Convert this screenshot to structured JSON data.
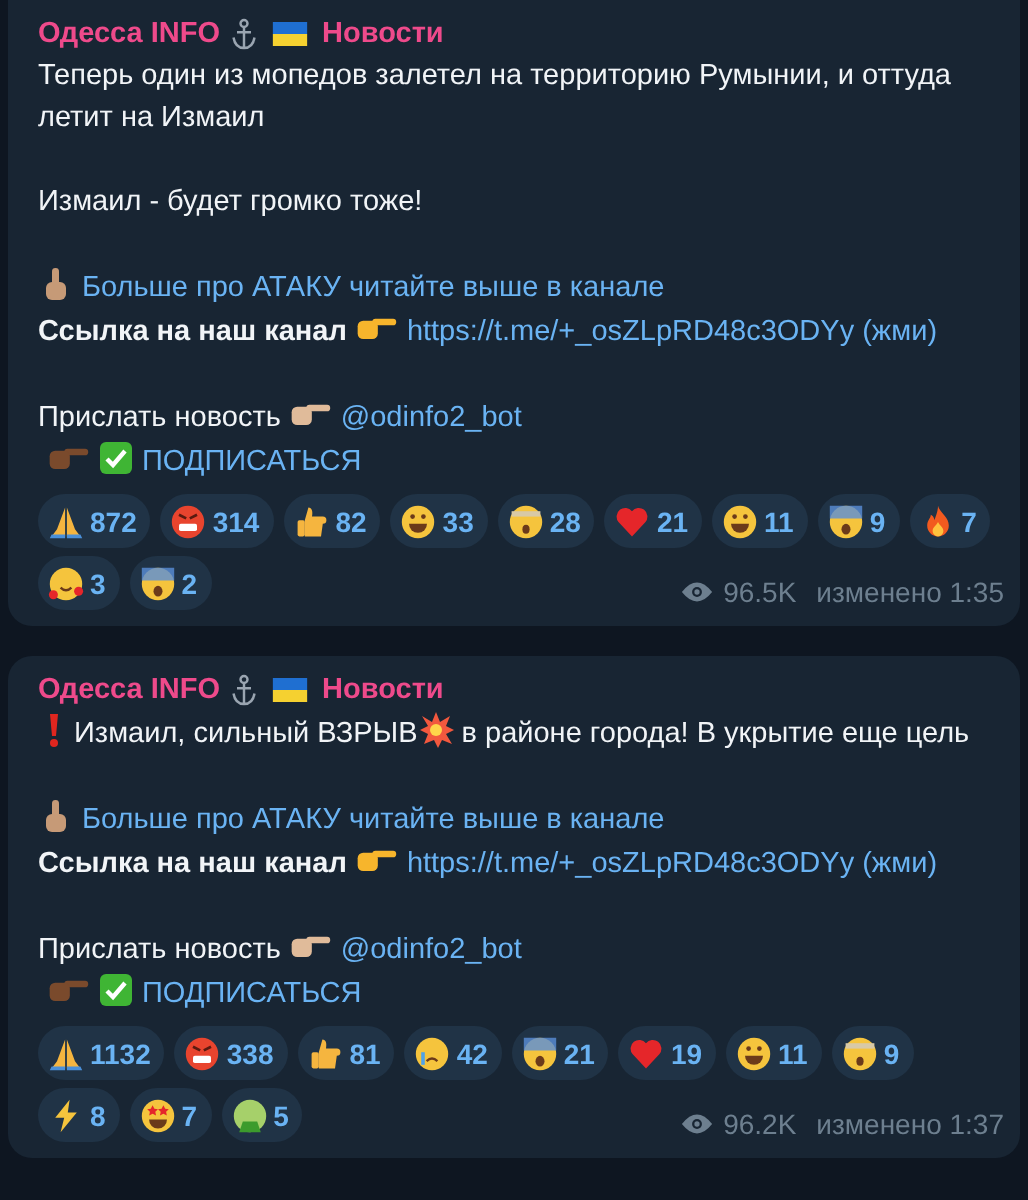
{
  "messages": [
    {
      "sender": "Одесса INFO",
      "channel": "Новости",
      "paragraphs": [
        {
          "lines": [
            [
              {
                "kind": "text",
                "text": "Теперь один из мопедов залетел на территорию Румынии, и оттуда летит на Измаил"
              }
            ]
          ]
        },
        {
          "lines": [
            [
              {
                "kind": "text",
                "text": "Измаил - будет громко тоже!"
              }
            ]
          ]
        },
        {
          "lines": [
            [
              {
                "kind": "point-up"
              },
              {
                "kind": "link",
                "text": "Больше про АТАКУ читайте выше в канале"
              }
            ],
            [
              {
                "kind": "bold",
                "text": "Ссылка на наш канал"
              },
              {
                "kind": "point-right"
              },
              {
                "kind": "link",
                "text": "https://t.me/+_osZLpRD48c3ODYy (жми)"
              }
            ]
          ]
        },
        {
          "lines": [
            [
              {
                "kind": "text",
                "text": "Прислать новость"
              },
              {
                "kind": "point-right-tan"
              },
              {
                "kind": "link",
                "text": "@odinfo2_bot"
              }
            ],
            [
              {
                "kind": "point-right-brown"
              },
              {
                "kind": "check"
              },
              {
                "kind": "link",
                "text": "ПОДПИСАТЬСЯ"
              }
            ]
          ]
        }
      ],
      "reactions": [
        {
          "kind": "pray",
          "count": "872"
        },
        {
          "kind": "angry",
          "count": "314"
        },
        {
          "kind": "thumbs",
          "count": "82"
        },
        {
          "kind": "laugh",
          "count": "33"
        },
        {
          "kind": "shock",
          "count": "28"
        },
        {
          "kind": "heart",
          "count": "21"
        },
        {
          "kind": "grin",
          "count": "11"
        },
        {
          "kind": "scream",
          "count": "9"
        },
        {
          "kind": "fire",
          "count": "7"
        },
        {
          "kind": "love",
          "count": "3"
        },
        {
          "kind": "fear",
          "count": "2"
        }
      ],
      "views": "96.5K",
      "edited": "изменено 1:35"
    },
    {
      "sender": "Одесса INFO",
      "channel": "Новости",
      "paragraphs": [
        {
          "lines": [
            [
              {
                "kind": "exclaim"
              },
              {
                "kind": "text",
                "text": "Измаил, сильный ВЗРЫВ"
              },
              {
                "kind": "boom"
              },
              {
                "kind": "text",
                "text": "в районе города! В укрытие  еще цель"
              }
            ]
          ]
        },
        {
          "lines": [
            [
              {
                "kind": "point-up"
              },
              {
                "kind": "link",
                "text": "Больше про АТАКУ читайте выше в канале"
              }
            ],
            [
              {
                "kind": "bold",
                "text": "Ссылка на наш канал"
              },
              {
                "kind": "point-right"
              },
              {
                "kind": "link",
                "text": "https://t.me/+_osZLpRD48c3ODYy (жми)"
              }
            ]
          ]
        },
        {
          "lines": [
            [
              {
                "kind": "text",
                "text": "Прислать новость"
              },
              {
                "kind": "point-right-tan"
              },
              {
                "kind": "link",
                "text": "@odinfo2_bot"
              }
            ],
            [
              {
                "kind": "point-right-brown"
              },
              {
                "kind": "check"
              },
              {
                "kind": "link",
                "text": "ПОДПИСАТЬСЯ"
              }
            ]
          ]
        }
      ],
      "reactions": [
        {
          "kind": "pray",
          "count": "1132"
        },
        {
          "kind": "angry",
          "count": "338"
        },
        {
          "kind": "thumbs",
          "count": "81"
        },
        {
          "kind": "cry",
          "count": "42"
        },
        {
          "kind": "scream",
          "count": "21"
        },
        {
          "kind": "heart",
          "count": "19"
        },
        {
          "kind": "laugh",
          "count": "11"
        },
        {
          "kind": "shock",
          "count": "9"
        },
        {
          "kind": "zap",
          "count": "8"
        },
        {
          "kind": "star",
          "count": "7"
        },
        {
          "kind": "sick",
          "count": "5"
        }
      ],
      "views": "96.2K",
      "edited": "изменено 1:37"
    }
  ]
}
